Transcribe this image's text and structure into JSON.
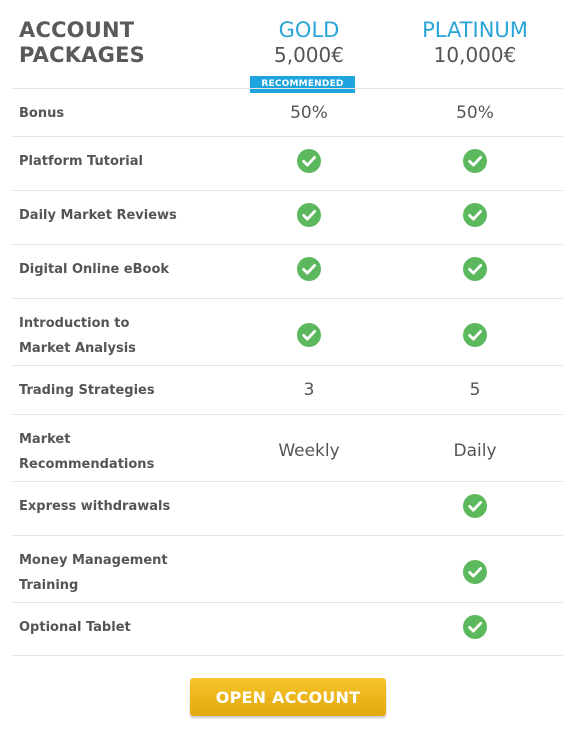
{
  "header": {
    "title_line1": "ACCOUNT",
    "title_line2": "PACKAGES",
    "plans": [
      {
        "name": "GOLD",
        "price": "5,000€"
      },
      {
        "name": "PLATINUM",
        "price": "10,000€"
      }
    ],
    "badge": "RECOMMENDED"
  },
  "rows": [
    {
      "feature": [
        "Bonus"
      ],
      "gold": "50%",
      "platinum": "50%"
    },
    {
      "feature": [
        "Platform Tutorial"
      ],
      "gold": "check",
      "platinum": "check"
    },
    {
      "feature": [
        "Daily Market Reviews"
      ],
      "gold": "check",
      "platinum": "check"
    },
    {
      "feature": [
        "Digital Online eBook"
      ],
      "gold": "check",
      "platinum": "check"
    },
    {
      "feature": [
        "Introduction to",
        "Market Analysis"
      ],
      "gold": "check",
      "platinum": "check"
    },
    {
      "feature": [
        "Trading Strategies"
      ],
      "gold": "3",
      "platinum": "5"
    },
    {
      "feature": [
        "Market",
        "Recommendations"
      ],
      "gold": "Weekly",
      "platinum": "Daily"
    },
    {
      "feature": [
        "Express withdrawals"
      ],
      "gold": "",
      "platinum": "check"
    },
    {
      "feature": [
        "Money Management",
        "Training"
      ],
      "gold": "",
      "platinum": "check"
    },
    {
      "feature": [
        "Optional Tablet"
      ],
      "gold": "",
      "platinum": "check"
    }
  ],
  "cta": {
    "label": "OPEN ACCOUNT"
  },
  "colors": {
    "plan_name": "#2aa4d8",
    "badge_bg": "#1ea5e0",
    "check_green": "#5cb85c",
    "cta_yellow": "#f2b81d"
  },
  "icons": {
    "check": "check-circle-icon"
  }
}
